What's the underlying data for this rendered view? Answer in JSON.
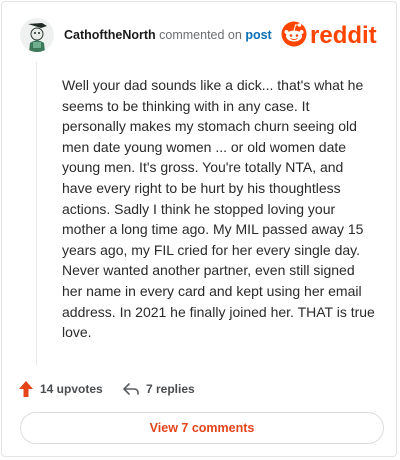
{
  "header": {
    "username": "CathoftheNorth",
    "verb": "commented on",
    "post_link": "post",
    "brand": "reddit"
  },
  "comment": {
    "body": "Well your dad sounds like a dick... that's what he seems to be thinking with in any case. It personally makes my stomach churn seeing old men date young women ... or old women date young men. It's gross. You're totally NTA, and have every right to be hurt by his thoughtless actions. Sadly I think he stopped loving your mother a long time ago. My MIL passed away 15 years ago, my FIL cried for her every single day. Never wanted another partner, even still signed her name in every card and kept using her email address. In 2021 he finally joined her. THAT is true love."
  },
  "actions": {
    "upvotes_label": "14 upvotes",
    "replies_label": "7 replies"
  },
  "footer": {
    "view_comments_label": "View 7 comments"
  },
  "colors": {
    "brand": "#ff4500",
    "link": "#0a6fb5",
    "view_button_text": "#e3441a"
  },
  "icons": {
    "avatar": "avatar-snoo",
    "logo": "reddit-logo-icon",
    "upvote": "upvote-arrow-icon",
    "reply": "reply-arrow-icon"
  }
}
